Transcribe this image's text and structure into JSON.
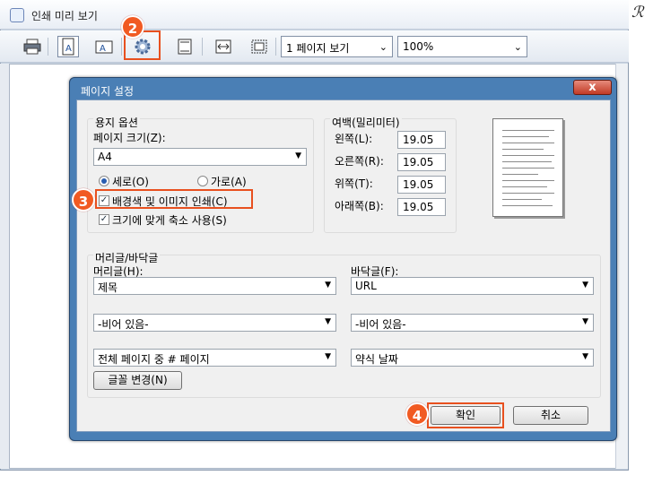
{
  "window": {
    "title": "인쇄 미리 보기"
  },
  "toolbar": {
    "print_icon": "printer-icon",
    "portrait_icon": "portrait-icon",
    "landscape_icon": "landscape-icon",
    "settings_icon": "gear-icon",
    "header_footer_icon": "header-footer-icon",
    "page_width_icon": "page-width-icon",
    "full_page_icon": "full-page-icon",
    "view_select": "1 페이지 보기",
    "zoom_select": "100%",
    "dropdown_arrow": "⌄"
  },
  "dialog": {
    "title": "페이지 설정",
    "close": "x",
    "paper_options": {
      "group_label": "용지 옵션",
      "page_size_label": "페이지 크기(Z):",
      "page_size": "A4",
      "portrait": "세로(O)",
      "landscape": "가로(A)",
      "print_background": "배경색 및 이미지 인쇄(C)",
      "shrink_to_fit": "크기에 맞게 축소 사용(S)"
    },
    "margins": {
      "group_label": "여백(밀리미터)",
      "left_label": "왼쪽(L):",
      "left": "19.05",
      "right_label": "오른쪽(R):",
      "right": "19.05",
      "top_label": "위쪽(T):",
      "top": "19.05",
      "bottom_label": "아래쪽(B):",
      "bottom": "19.05"
    },
    "header_footer": {
      "group_label": "머리글/바닥글",
      "header_label": "머리글(H):",
      "footer_label": "바닥글(F):",
      "header1": "제목",
      "header2": "-비어 있음-",
      "header3": "전체 페이지 중 # 페이지",
      "footer1": "URL",
      "footer2": "-비어 있음-",
      "footer3": "약식 날짜",
      "font_button": "글꼴 변경(N)"
    },
    "ok": "확인",
    "cancel": "취소"
  },
  "badges": {
    "b2": "2",
    "b3": "3",
    "b4": "4"
  },
  "watermark": "ℛ",
  "colors": {
    "accent": "#f15a22",
    "dialog_frame": "#4a7fb5",
    "highlight": "#e8501f"
  }
}
